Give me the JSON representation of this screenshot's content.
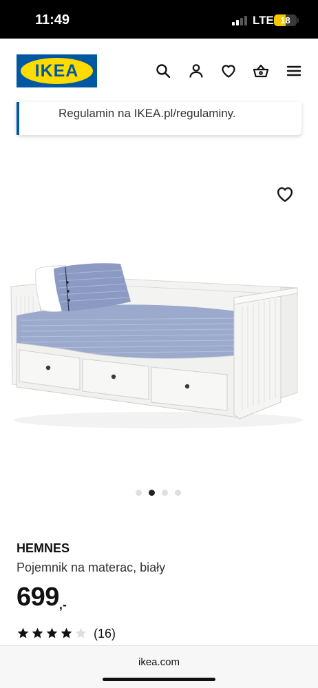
{
  "status_bar": {
    "time": "11:49",
    "network": "LTE",
    "battery": "18",
    "battery_color": "#f6c700"
  },
  "header": {
    "logo_text": "IKEA",
    "brand_blue": "#0058a3",
    "brand_yellow": "#ffdb00",
    "icons": [
      "search-icon",
      "user-icon",
      "heart-icon",
      "basket-icon",
      "menu-icon"
    ]
  },
  "banner": {
    "text": "Regulamin na IKEA.pl/regulaminy."
  },
  "product": {
    "image_icon": "daybed-image",
    "carousel_total": 4,
    "carousel_active": 2,
    "name": "HEMNES",
    "description": "Pojemnik na materac, biały",
    "price_integer": "699",
    "price_decimal": ",-",
    "rating_stars": 4,
    "rating_max": 5,
    "rating_count": "(16)"
  },
  "browser": {
    "url": "ikea.com"
  }
}
